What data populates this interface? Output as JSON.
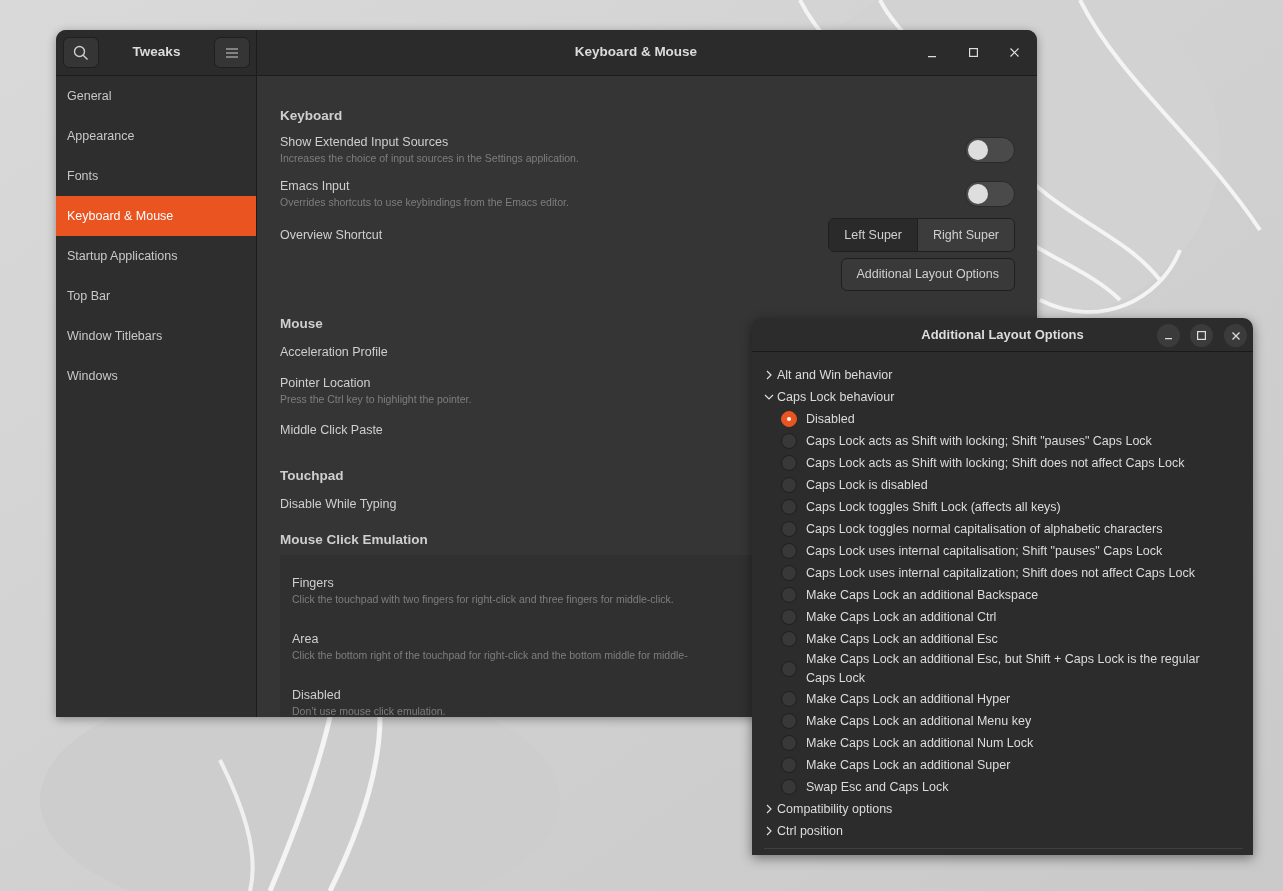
{
  "main_window": {
    "app_title": "Tweaks",
    "title": "Keyboard & Mouse",
    "sidebar": {
      "items": [
        {
          "label": "General",
          "selected": false
        },
        {
          "label": "Appearance",
          "selected": false
        },
        {
          "label": "Fonts",
          "selected": false
        },
        {
          "label": "Keyboard & Mouse",
          "selected": true
        },
        {
          "label": "Startup Applications",
          "selected": false
        },
        {
          "label": "Top Bar",
          "selected": false
        },
        {
          "label": "Window Titlebars",
          "selected": false
        },
        {
          "label": "Windows",
          "selected": false
        }
      ]
    },
    "sections": [
      {
        "heading": "Keyboard",
        "rows": [
          {
            "kind": "switch",
            "label": "Show Extended Input Sources",
            "description": "Increases the choice of input sources in the Settings application.",
            "on": false
          },
          {
            "kind": "switch",
            "label": "Emacs Input",
            "description": "Overrides shortcuts to use keybindings from the Emacs editor.",
            "on": false
          },
          {
            "kind": "segmented",
            "label": "Overview Shortcut",
            "options": [
              {
                "label": "Left Super",
                "selected": true
              },
              {
                "label": "Right Super",
                "selected": false
              }
            ]
          },
          {
            "kind": "button",
            "label": "Additional Layout Options"
          }
        ]
      },
      {
        "heading": "Mouse",
        "rows": [
          {
            "kind": "setting",
            "label": "Acceleration Profile"
          },
          {
            "kind": "setting",
            "label": "Pointer Location",
            "description": "Press the Ctrl key to highlight the pointer."
          },
          {
            "kind": "setting",
            "label": "Middle Click Paste"
          }
        ]
      },
      {
        "heading": "Touchpad",
        "rows": [
          {
            "kind": "setting",
            "label": "Disable While Typing"
          }
        ]
      },
      {
        "heading": "Mouse Click Emulation",
        "rows": [
          {
            "kind": "options",
            "items": [
              {
                "label": "Fingers",
                "description": "Click the touchpad with two fingers for right-click and three fingers for middle-click."
              },
              {
                "label": "Area",
                "description": "Click the bottom right of the touchpad for right-click and the bottom middle for middle-"
              },
              {
                "label": "Disabled",
                "description": "Don’t use mouse click emulation."
              }
            ]
          }
        ]
      }
    ]
  },
  "dialog": {
    "title": "Additional Layout Options",
    "tree": [
      {
        "label": "Alt and Win behavior",
        "expanded": false
      },
      {
        "label": "Caps Lock behaviour",
        "expanded": true,
        "children": [
          {
            "label": "Disabled",
            "selected": true
          },
          {
            "label": "Caps Lock acts as Shift with locking; Shift \"pauses\" Caps Lock",
            "selected": false
          },
          {
            "label": "Caps Lock acts as Shift with locking; Shift does not affect Caps Lock",
            "selected": false
          },
          {
            "label": "Caps Lock is disabled",
            "selected": false
          },
          {
            "label": "Caps Lock toggles Shift Lock (affects all keys)",
            "selected": false
          },
          {
            "label": "Caps Lock toggles normal capitalisation of alphabetic characters",
            "selected": false
          },
          {
            "label": "Caps Lock uses internal capitalisation; Shift \"pauses\" Caps Lock",
            "selected": false
          },
          {
            "label": "Caps Lock uses internal capitalization; Shift does not affect Caps Lock",
            "selected": false
          },
          {
            "label": "Make Caps Lock an additional Backspace",
            "selected": false
          },
          {
            "label": "Make Caps Lock an additional Ctrl",
            "selected": false
          },
          {
            "label": "Make Caps Lock an additional Esc",
            "selected": false
          },
          {
            "label": "Make Caps Lock an additional Esc, but Shift + Caps Lock is the regular Caps Lock",
            "selected": false
          },
          {
            "label": "Make Caps Lock an additional Hyper",
            "selected": false
          },
          {
            "label": "Make Caps Lock an additional Menu key",
            "selected": false
          },
          {
            "label": "Make Caps Lock an additional Num Lock",
            "selected": false
          },
          {
            "label": "Make Caps Lock an additional Super",
            "selected": false
          },
          {
            "label": "Swap Esc and Caps Lock",
            "selected": false
          }
        ]
      },
      {
        "label": "Compatibility options",
        "expanded": false
      },
      {
        "label": "Ctrl position",
        "expanded": false
      }
    ]
  }
}
